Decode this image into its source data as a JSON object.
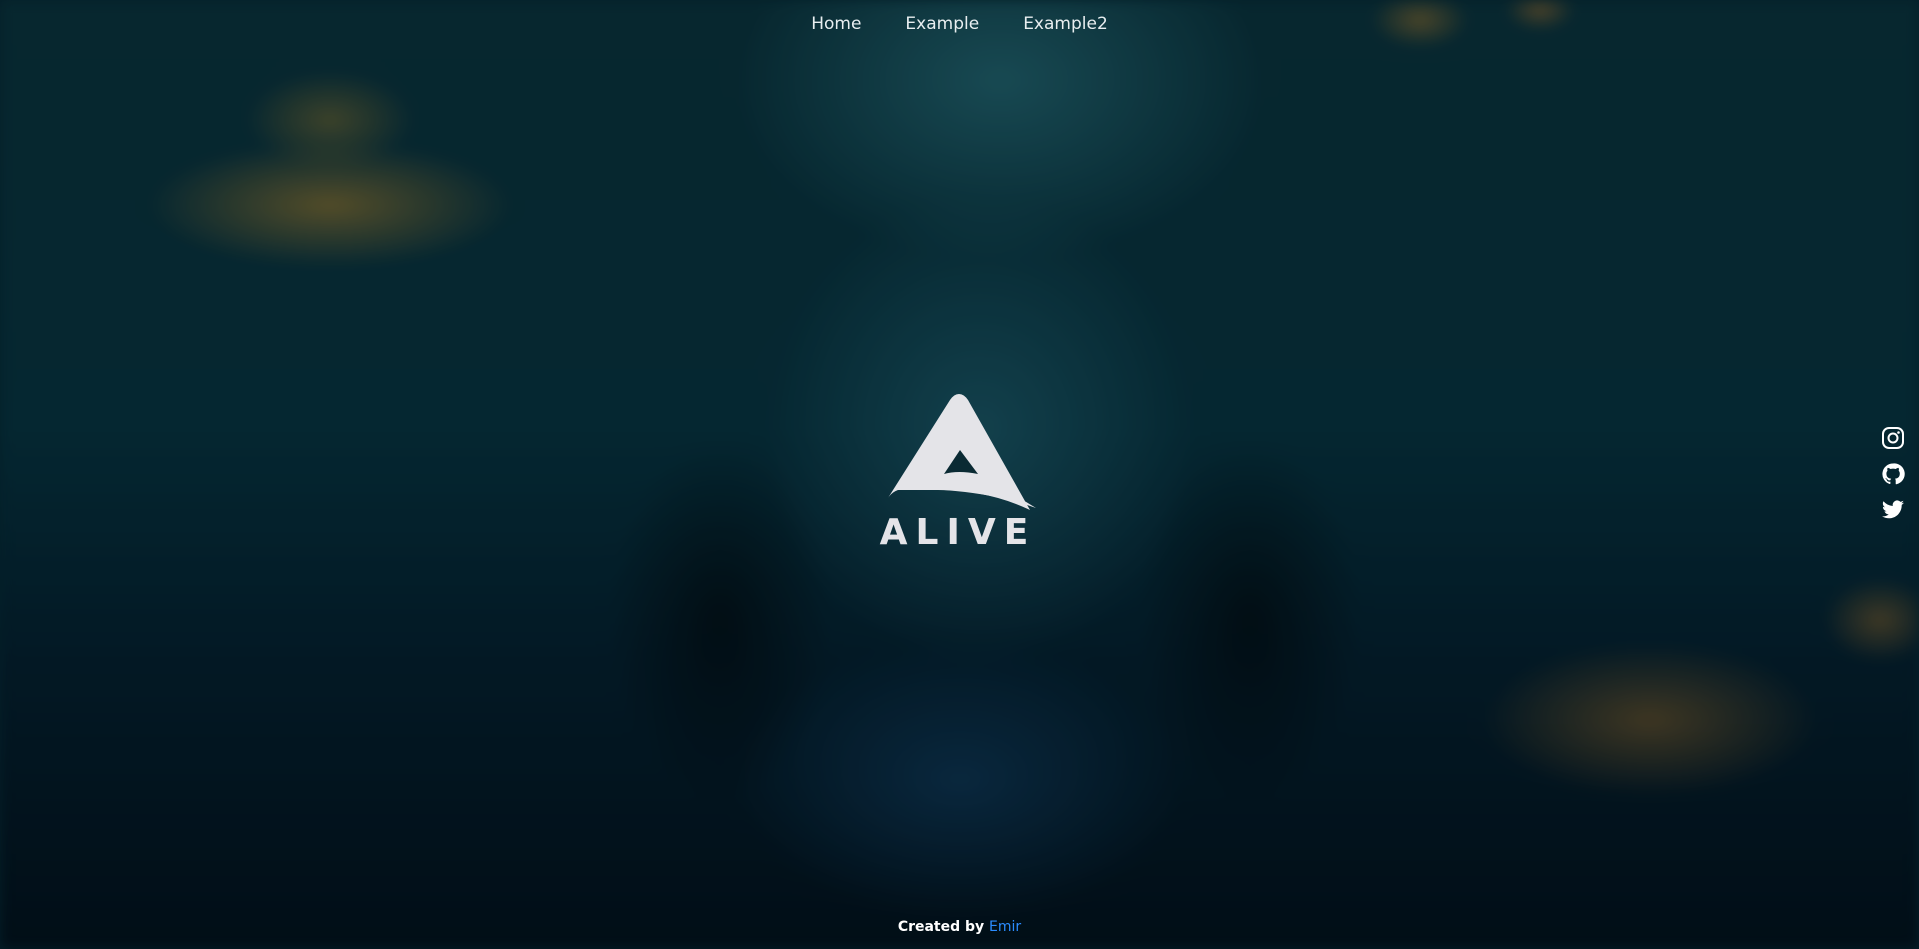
{
  "nav": {
    "items": [
      "Home",
      "Example",
      "Example2"
    ]
  },
  "logo": {
    "text": "ALIVE"
  },
  "social": {
    "icons": [
      "instagram-icon",
      "github-icon",
      "twitter-icon"
    ]
  },
  "footer": {
    "prefix": "Created by",
    "author": "Emir"
  },
  "colors": {
    "accent": "#2b8cff",
    "text": "#e8eef0"
  }
}
